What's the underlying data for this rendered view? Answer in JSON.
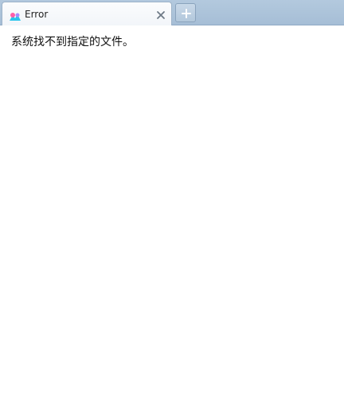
{
  "tabs": [
    {
      "title": "Error",
      "icon": "colorful-browser-favicon-icon",
      "active": true
    }
  ],
  "new_tab_icon": "plus-icon",
  "close_icon": "close-icon",
  "page": {
    "message": "系统找不到指定的文件。"
  },
  "colors": {
    "tab_strip": "#a6bed6",
    "tab_active": "#f2f5f9",
    "content_bg": "#ffffff"
  }
}
